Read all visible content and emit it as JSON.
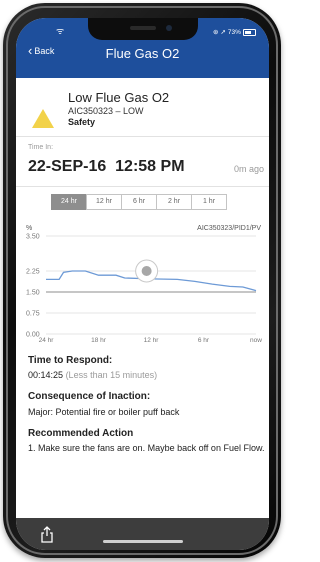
{
  "status": {
    "battery": "73%"
  },
  "nav": {
    "back_label": "Back",
    "title": "Flue Gas O2"
  },
  "alert": {
    "title": "Low Flue Gas O2",
    "code": "AIC350323 – LOW",
    "category": "Safety",
    "icon": "warning-triangle-icon",
    "icon_color": "#f2d24a"
  },
  "time_in": {
    "label": "Time In:",
    "value": "22-SEP-16  12:58 PM",
    "ago": "0m ago"
  },
  "range": {
    "options": [
      "24 hr",
      "12 hr",
      "6 hr",
      "2 hr",
      "1 hr"
    ],
    "selected": "24 hr"
  },
  "chart_data": {
    "type": "line",
    "tag": "AIC350323/PID1/PV",
    "ylabel": "%",
    "ylim": [
      0,
      3.5
    ],
    "yticks": [
      "3.50",
      "2.25",
      "1.50",
      "0.75",
      "0.00"
    ],
    "xticks": [
      "24 hr",
      "18 hr",
      "12 hr",
      "6 hr",
      "now"
    ],
    "grid": true,
    "series": [
      {
        "color": "#6d9ad6",
        "x": [
          0,
          1.5,
          2.0,
          3.0,
          4.5,
          6.0,
          8.0,
          9.0,
          12.0,
          15.0,
          17.0,
          19.0,
          21.0,
          22.5,
          24.0
        ],
        "y": [
          1.95,
          1.95,
          2.2,
          2.25,
          2.25,
          2.1,
          2.1,
          2.0,
          1.97,
          1.95,
          1.88,
          1.78,
          1.7,
          1.68,
          1.55
        ]
      },
      {
        "color": "#8e8e8e",
        "x": [
          0,
          24
        ],
        "y": [
          1.5,
          1.5
        ]
      }
    ],
    "marker": {
      "x": 11.5,
      "y": 2.25
    }
  },
  "respond": {
    "label": "Time to Respond:",
    "time": "00:14:25",
    "note": "(Less than 15 minutes)"
  },
  "consequence": {
    "label": "Consequence of Inaction:",
    "text": "Major: Potential fire or boiler puff back"
  },
  "recommend": {
    "label": "Recommended Action",
    "text": "1. Make sure the fans are on.  Maybe back off on Fuel Flow."
  },
  "toolbar": {
    "share_icon": "share-icon"
  }
}
